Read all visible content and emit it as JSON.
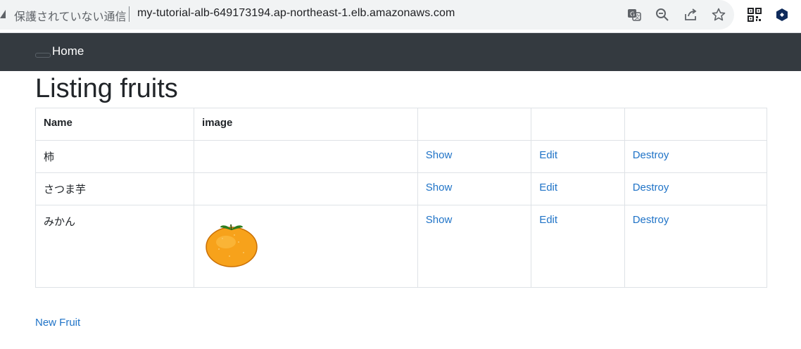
{
  "browser": {
    "security_label": "保護されていない通信",
    "url": "my-tutorial-alb-649173194.ap-northeast-1.elb.amazonaws.com",
    "icons": [
      "warning-icon",
      "translate-icon",
      "zoom-icon",
      "share-icon",
      "star-icon",
      "qr-code-icon",
      "extension-icon"
    ]
  },
  "navbar": {
    "home_label": "Home",
    "background": "#343a40"
  },
  "page": {
    "title": "Listing fruits",
    "new_link": "New Fruit"
  },
  "table": {
    "headers": [
      "Name",
      "image",
      "",
      "",
      ""
    ],
    "rows": [
      {
        "name": "柿",
        "has_image": false,
        "show": "Show",
        "edit": "Edit",
        "destroy": "Destroy"
      },
      {
        "name": "さつま芋",
        "has_image": false,
        "show": "Show",
        "edit": "Edit",
        "destroy": "Destroy"
      },
      {
        "name": "みかん",
        "has_image": true,
        "image_icon": "mikan-orange-icon",
        "show": "Show",
        "edit": "Edit",
        "destroy": "Destroy"
      }
    ]
  },
  "colors": {
    "link": "#1f73c7",
    "border": "#dee2e6"
  }
}
